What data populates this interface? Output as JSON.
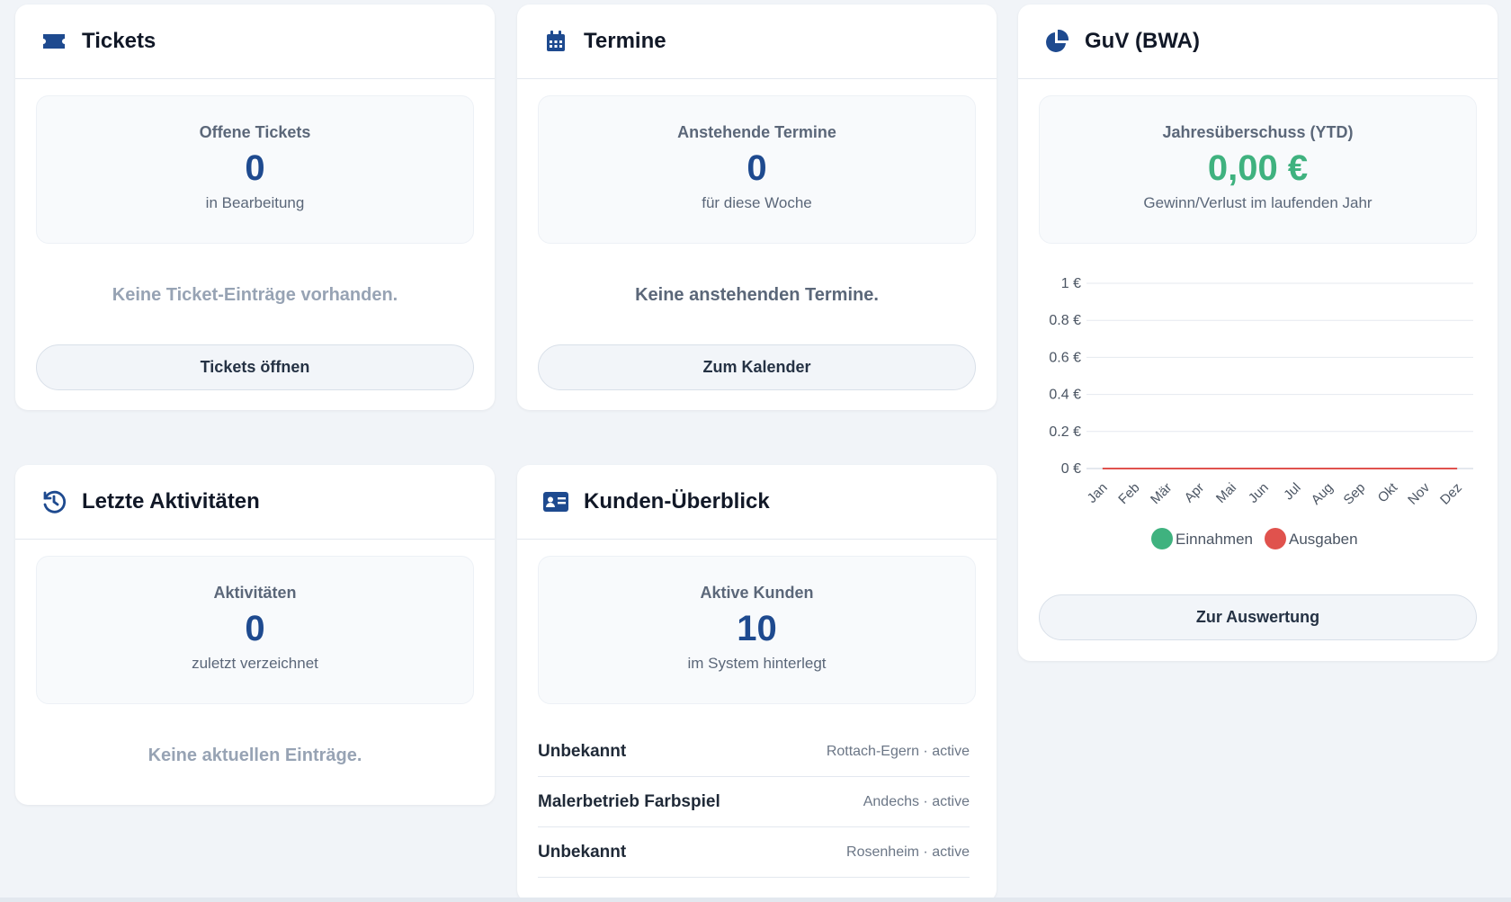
{
  "colors": {
    "accent": "#1e4a8f",
    "income": "#3fb27f",
    "expense": "#e0524d"
  },
  "tickets": {
    "title": "Tickets",
    "icon": "ticket-icon",
    "stat_label": "Offene Tickets",
    "stat_value": "0",
    "stat_sub": "in Bearbeitung",
    "empty": "Keine Ticket-Einträge vorhanden.",
    "button": "Tickets öffnen"
  },
  "termine": {
    "title": "Termine",
    "icon": "calendar-icon",
    "stat_label": "Anstehende Termine",
    "stat_value": "0",
    "stat_sub": "für diese Woche",
    "empty": "Keine anstehenden Termine.",
    "button": "Zum Kalender"
  },
  "guv": {
    "title": "GuV (BWA)",
    "icon": "pie-chart-icon",
    "stat_label": "Jahresüberschuss (YTD)",
    "stat_value": "0,00 €",
    "stat_sub": "Gewinn/Verlust im laufenden Jahr",
    "button": "Zur Auswertung"
  },
  "aktivitaeten": {
    "title": "Letzte Aktivitäten",
    "icon": "history-icon",
    "stat_label": "Aktivitäten",
    "stat_value": "0",
    "stat_sub": "zuletzt verzeichnet",
    "empty": "Keine aktuellen Einträge."
  },
  "kunden": {
    "title": "Kunden-Überblick",
    "icon": "id-card-icon",
    "stat_label": "Aktive Kunden",
    "stat_value": "10",
    "stat_sub": "im System hinterlegt",
    "rows": [
      {
        "name": "Unbekannt",
        "meta": "Rottach-Egern · active"
      },
      {
        "name": "Malerbetrieb Farbspiel",
        "meta": "Andechs · active"
      },
      {
        "name": "Unbekannt",
        "meta": "Rosenheim · active"
      }
    ]
  },
  "chart_data": {
    "type": "line",
    "categories": [
      "Jan",
      "Feb",
      "Mär",
      "Apr",
      "Mai",
      "Jun",
      "Jul",
      "Aug",
      "Sep",
      "Okt",
      "Nov",
      "Dez"
    ],
    "series": [
      {
        "name": "Einnahmen",
        "values": [
          0,
          0,
          0,
          0,
          0,
          0,
          0,
          0,
          0,
          0,
          0,
          0
        ],
        "color": "#3fb27f"
      },
      {
        "name": "Ausgaben",
        "values": [
          0,
          0,
          0,
          0,
          0,
          0,
          0,
          0,
          0,
          0,
          0,
          0
        ],
        "color": "#e0524d"
      }
    ],
    "y_ticks": [
      "0 €",
      "0.2 €",
      "0.4 €",
      "0.6 €",
      "0.8 €",
      "1 €"
    ],
    "ylim": [
      0,
      1
    ],
    "grid": true,
    "legend": "bottom"
  }
}
